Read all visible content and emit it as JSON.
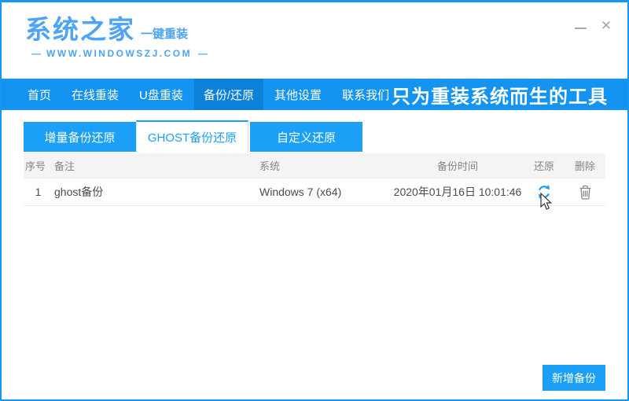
{
  "window_controls": {
    "minimize_icon": "minimize",
    "close_glyph": "✕"
  },
  "header": {
    "logo": "系统之家",
    "logo_sub": "一键重装",
    "dash": "—",
    "website": "WWW.WINDOWSZJ.COM"
  },
  "nav": {
    "items": [
      {
        "label": "首页",
        "active": false
      },
      {
        "label": "在线重装",
        "active": false
      },
      {
        "label": "U盘重装",
        "active": false
      },
      {
        "label": "备份/还原",
        "active": true
      },
      {
        "label": "其他设置",
        "active": false
      },
      {
        "label": "联系我们",
        "active": false
      }
    ],
    "slogan": "只为重装系统而生的工具"
  },
  "tabs": [
    {
      "label": "增量备份还原",
      "active": false
    },
    {
      "label": "GHOST备份还原",
      "active": true
    },
    {
      "label": "自定义还原",
      "active": false
    }
  ],
  "table": {
    "headers": [
      "序号",
      "备注",
      "系统",
      "备份时间",
      "还原",
      "删除"
    ],
    "rows": [
      {
        "index": "1",
        "note": "ghost备份",
        "system": "Windows 7 (x64)",
        "time": "2020年01月16日 10:01:46"
      }
    ]
  },
  "footer": {
    "add_backup_label": "新增备份"
  },
  "colors": {
    "primary_blue": "#1697f4",
    "nav_blue": "#1593f0",
    "nav_active_blue": "#0d80d8",
    "tab_blue": "#1b9ff7",
    "logo_blue": "#4da3f7",
    "header_gray_bg": "#f4f4f4",
    "header_text": "#858585",
    "row_text": "#4c4c4c"
  }
}
